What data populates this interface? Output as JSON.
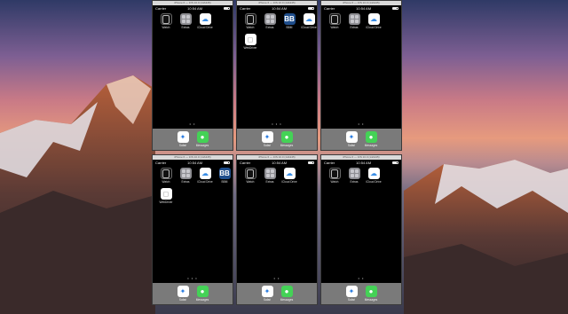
{
  "desktop": {
    "wallpaper": "macOS Sierra mountain sunset"
  },
  "colors": {
    "dock": "#7a7a7a",
    "screen": "#000000",
    "titlebar": "#d9d9d9"
  },
  "simulators": [
    {
      "window_title": "iPhone 6 — iOS 10.0 (14A345)",
      "carrier": "Carrier",
      "time": "10:54 AM",
      "apps": [
        {
          "label": "Watch",
          "icon": "watch-icon",
          "kind": "watch"
        },
        {
          "label": "Extras",
          "icon": "extras-folder-icon",
          "kind": "extras"
        },
        {
          "label": "iCloud Drive",
          "icon": "icloud-drive-icon",
          "kind": "icloud"
        }
      ],
      "dots": "• •",
      "dock": [
        {
          "label": "Safari",
          "icon": "safari-icon"
        },
        {
          "label": "Messages",
          "icon": "messages-icon"
        }
      ]
    },
    {
      "window_title": "iPhone 6 — iOS 10.0 (14A345)",
      "carrier": "Carrier",
      "time": "10:54 AM",
      "apps": [
        {
          "label": "Watch",
          "icon": "watch-icon",
          "kind": "watch"
        },
        {
          "label": "Extras",
          "icon": "extras-folder-icon",
          "kind": "extras"
        },
        {
          "label": "BBM",
          "icon": "bbm-icon",
          "kind": "bbm"
        },
        {
          "label": "iCloud Drive",
          "icon": "icloud-drive-icon",
          "kind": "icloud"
        },
        {
          "label": "WebDriver",
          "icon": "webdriver-icon",
          "kind": "webdriver"
        }
      ],
      "dots": "• • •",
      "dock": [
        {
          "label": "Safari",
          "icon": "safari-icon"
        },
        {
          "label": "Messages",
          "icon": "messages-icon"
        }
      ]
    },
    {
      "window_title": "iPhone 6 — iOS 10.0 (14A345)",
      "carrier": "Carrier",
      "time": "10:54 AM",
      "apps": [
        {
          "label": "Watch",
          "icon": "watch-icon",
          "kind": "watch"
        },
        {
          "label": "Extras",
          "icon": "extras-folder-icon",
          "kind": "extras"
        },
        {
          "label": "iCloud Drive",
          "icon": "icloud-drive-icon",
          "kind": "icloud"
        }
      ],
      "dots": "• •",
      "dock": [
        {
          "label": "Safari",
          "icon": "safari-icon"
        },
        {
          "label": "Messages",
          "icon": "messages-icon"
        }
      ]
    },
    {
      "window_title": "iPhone 6 — iOS 10.0 (14A345)",
      "carrier": "Carrier",
      "time": "10:54 AM",
      "apps": [
        {
          "label": "Watch",
          "icon": "watch-icon",
          "kind": "watch"
        },
        {
          "label": "Extras",
          "icon": "extras-folder-icon",
          "kind": "extras"
        },
        {
          "label": "iCloud Drive",
          "icon": "icloud-drive-icon",
          "kind": "icloud"
        },
        {
          "label": "BBM",
          "icon": "bbm-icon",
          "kind": "bbm"
        },
        {
          "label": "WebDriver",
          "icon": "webdriver-icon",
          "kind": "webdriver"
        }
      ],
      "dots": "• • •",
      "dock": [
        {
          "label": "Safari",
          "icon": "safari-icon"
        },
        {
          "label": "Messages",
          "icon": "messages-icon"
        }
      ]
    },
    {
      "window_title": "iPhone 6 — iOS 10.0 (14A345)",
      "carrier": "Carrier",
      "time": "10:54 AM",
      "apps": [
        {
          "label": "Watch",
          "icon": "watch-icon",
          "kind": "watch"
        },
        {
          "label": "Extras",
          "icon": "extras-folder-icon",
          "kind": "extras"
        },
        {
          "label": "iCloud Drive",
          "icon": "icloud-drive-icon",
          "kind": "icloud"
        }
      ],
      "dots": "• •",
      "dock": [
        {
          "label": "Safari",
          "icon": "safari-icon"
        },
        {
          "label": "Messages",
          "icon": "messages-icon"
        }
      ]
    },
    {
      "window_title": "iPhone 6 — iOS 10.0 (14A345)",
      "carrier": "Carrier",
      "time": "10:54 AM",
      "apps": [
        {
          "label": "Watch",
          "icon": "watch-icon",
          "kind": "watch"
        },
        {
          "label": "Extras",
          "icon": "extras-folder-icon",
          "kind": "extras"
        },
        {
          "label": "iCloud Drive",
          "icon": "icloud-drive-icon",
          "kind": "icloud"
        }
      ],
      "dots": "• •",
      "dock": [
        {
          "label": "Safari",
          "icon": "safari-icon"
        },
        {
          "label": "Messages",
          "icon": "messages-icon"
        }
      ]
    }
  ]
}
